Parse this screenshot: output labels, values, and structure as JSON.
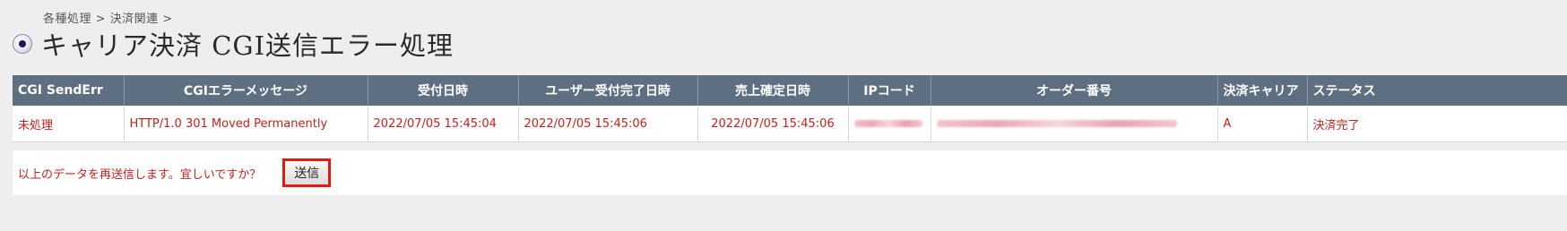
{
  "breadcrumb": "各種処理 > 決済関連 >",
  "page_title": "キャリア決済 CGI送信エラー処理",
  "table": {
    "headers": [
      "CGI SendErr",
      "CGIエラーメッセージ",
      "受付日時",
      "ユーザー受付完了日時",
      "売上確定日時",
      "IPコード",
      "オーダー番号",
      "決済キャリア",
      "ステータス"
    ],
    "row": {
      "cgi_senderr": "未処理",
      "cgi_error_message": "HTTP/1.0 301 Moved Permanently",
      "received_at": "2022/07/05 15:45:04",
      "user_completed_at": "2022/07/05 15:45:06",
      "sales_confirmed_at": "2022/07/05 15:45:06",
      "ip_code": "",
      "order_number": "",
      "carrier": "A",
      "status": "決済完了"
    }
  },
  "confirm": {
    "message": "以上のデータを再送信します。宜しいですか？",
    "button_label": "送信"
  },
  "colors": {
    "header_bg": "#5e6f82",
    "error_text": "#c8201a",
    "highlight_border": "#e8190c",
    "page_bg": "#eeeeee"
  }
}
